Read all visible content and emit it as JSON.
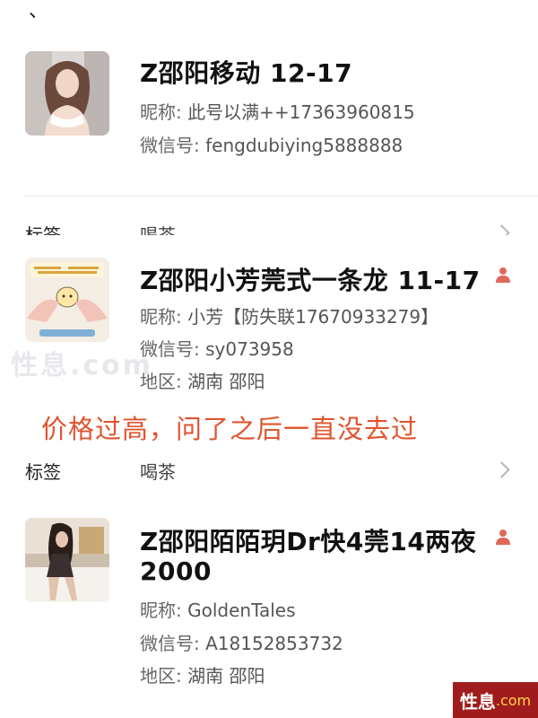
{
  "stray_mark": "、",
  "contacts": [
    {
      "name": "Z邵阳移动 12-17",
      "nickname_label": "昵称:",
      "nickname": "此号以满++17363960815",
      "wechat_label": "微信号:",
      "wechat": "fengdubiying5888888"
    },
    {
      "name": "Z邵阳小芳莞式一条龙 11-17",
      "nickname_label": "昵称:",
      "nickname": "小芳【防失联17670933279】",
      "wechat_label": "微信号:",
      "wechat": "sy073958",
      "region_label": "地区:",
      "region": "湖南  邵阳"
    },
    {
      "name_line1": "Z邵阳陌陌玥Dr快4莞14两夜",
      "name_line2": "2000",
      "nickname_label": "昵称:",
      "nickname": "GoldenTales",
      "wechat_label": "微信号:",
      "wechat": "A18152853732",
      "region_label": "地区:",
      "region": "湖南  邵阳"
    }
  ],
  "tags": [
    {
      "label": "标签",
      "value": "喝茶"
    },
    {
      "label": "标签",
      "value": "喝茶"
    }
  ],
  "annotation": "价格过高，问了之后一直没去过",
  "watermarks": {
    "faint": "性息.com",
    "footer_main": "性息",
    "footer_suffix": ".com"
  },
  "icons": {
    "person_icon_color": "#e0685a",
    "chevron": "chevron-right-icon"
  },
  "colors": {
    "annotation": "#e0542f",
    "footer_bg": "#a01c1c"
  }
}
